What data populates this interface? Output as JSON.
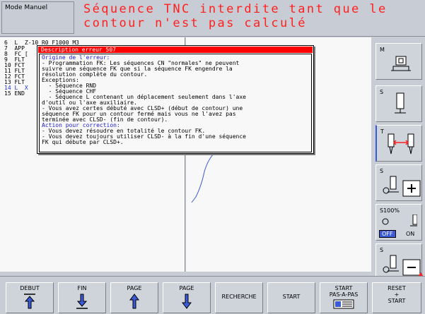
{
  "header": {
    "mode": "Mode Manuel",
    "message_line1": "Séquence TNC interdite tant que le",
    "message_line2": "contour n'est pas calculé"
  },
  "program": {
    "lines": [
      "6  L  Z-10 R0 F1000 M3",
      "7  APP",
      "8  FC [",
      "9  FLT",
      "10 FCT",
      "11 FLT",
      "12 FCT",
      "13 FLT",
      "14 L  X",
      "15 END"
    ],
    "current_index": 8
  },
  "error": {
    "title": "Description erreur  507",
    "body": [
      {
        "text": "Origine de l'erreur:",
        "blue": true
      },
      {
        "text": "- Programmation FK: Les séquences CN \"normales\" ne peuvent",
        "blue": false
      },
      {
        "text": "suivre une séquence FK que si la séquence FK engendre la",
        "blue": false
      },
      {
        "text": "résolution complète du contour.",
        "blue": false
      },
      {
        "text": "Exceptions:",
        "blue": false
      },
      {
        "text": "  - Séquence RND",
        "blue": false
      },
      {
        "text": "  - Séquence CHF",
        "blue": false
      },
      {
        "text": "  - Séquence L contenant un déplacement seulement dans l'axe",
        "blue": false
      },
      {
        "text": "d'outil ou l'axe auxiliaire.",
        "blue": false
      },
      {
        "text": "- Vous avez certes débuté avec CLSD+ (début de contour) une",
        "blue": false
      },
      {
        "text": "séquence FK pour un contour fermé mais vous ne l'avez pas",
        "blue": false
      },
      {
        "text": "terminée avec CLSD- (fin de contour).",
        "blue": false
      },
      {
        "text": "Action pour correction:",
        "blue": true
      },
      {
        "text": "- Vous devez résoudre en totalité le contour FK.",
        "blue": false
      },
      {
        "text": "- Vous devez toujours utiliser CLSD- à la fin d'une séquence",
        "blue": false
      },
      {
        "text": "FK qui débute par CLSD+.",
        "blue": false
      }
    ]
  },
  "vsoft": {
    "m": "M",
    "s1": "S",
    "t": "T",
    "s2": "S",
    "s100": "S100%",
    "off": "OFF",
    "on": "ON",
    "s3": "S"
  },
  "hsoft": {
    "debut": "DEBUT",
    "fin": "FIN",
    "page1": "PAGE",
    "page2": "PAGE",
    "recherche": "RECHERCHE",
    "start": "START",
    "start_pap_1": "START",
    "start_pap_2": "PAS-A-PAS",
    "reset_1": "RESET",
    "reset_2": "+",
    "reset_3": "START"
  },
  "colors": {
    "message": "#ff2020",
    "error_title_bg": "#ff0000",
    "error_blue": "#1a1ad6",
    "highlight_blue": "#3a5ad8"
  }
}
